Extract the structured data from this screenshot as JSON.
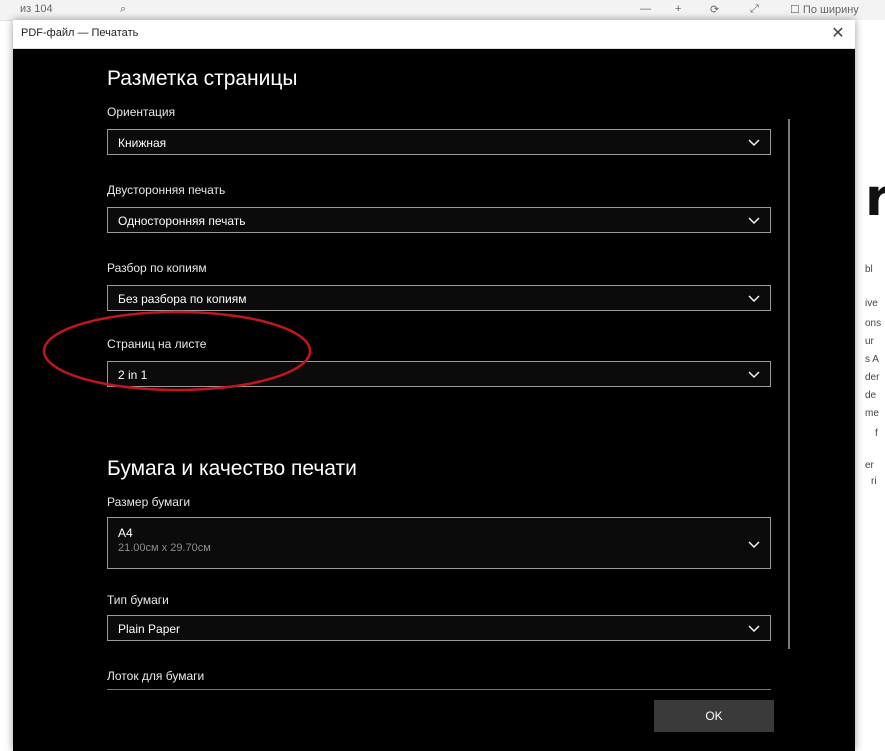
{
  "background": {
    "topbar": {
      "page_count": "из 104",
      "fit_label": "По ширину"
    },
    "page_fragments": [
      "bl",
      "ive",
      "ons",
      "ur",
      "s A",
      "der",
      "de",
      "me",
      "f",
      "er",
      "ri"
    ],
    "big_char": "r"
  },
  "dialog": {
    "title": "PDF-файл — Печатать",
    "close_symbol": "✕",
    "page_layout": {
      "heading": "Разметка страницы",
      "orientation": {
        "label": "Ориентация",
        "value": "Книжная"
      },
      "duplex": {
        "label": "Двусторонняя печать",
        "value": "Односторонняя печать"
      },
      "collation": {
        "label": "Разбор по копиям",
        "value": "Без разбора по копиям"
      },
      "pages_per_sheet": {
        "label": "Страниц на листе",
        "value": "2 in 1"
      }
    },
    "paper_quality": {
      "heading": "Бумага и качество печати",
      "paper_size": {
        "label": "Размер бумаги",
        "value": "A4",
        "subvalue": "21.00см x 29.70см"
      },
      "paper_type": {
        "label": "Тип бумаги",
        "value": "Plain Paper"
      },
      "paper_tray": {
        "label": "Лоток для бумаги"
      }
    },
    "ok_label": "OK",
    "highlight_color": "#c0161d"
  }
}
